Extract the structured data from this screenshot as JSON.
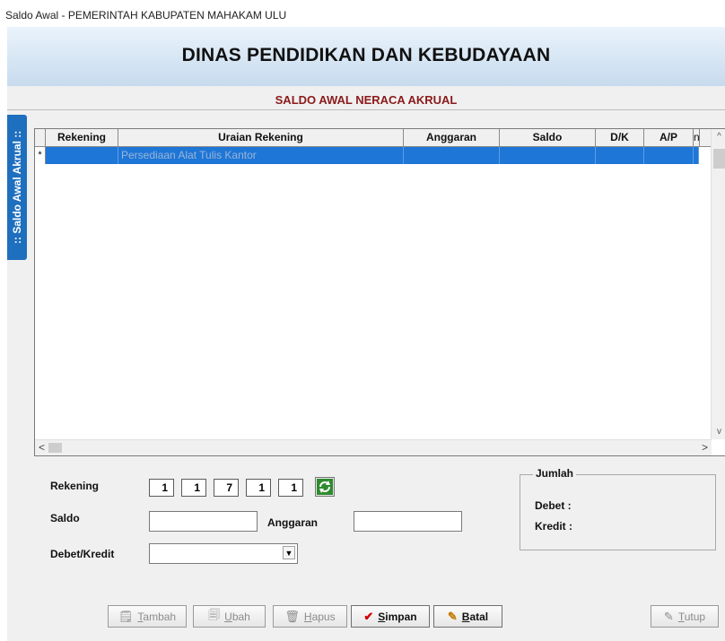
{
  "window": {
    "title": "Saldo Awal - PEMERINTAH KABUPATEN MAHAKAM ULU"
  },
  "header": {
    "title": "DINAS PENDIDIKAN DAN KEBUDAYAAN",
    "subtitle": "SALDO AWAL NERACA AKRUAL"
  },
  "sidetab": {
    "label": ":: Saldo Awal Akrual ::"
  },
  "grid": {
    "columns": [
      "Rekening",
      "Uraian Rekening",
      "Anggaran",
      "Saldo",
      "D/K",
      "A/P",
      "n"
    ],
    "rows": [
      {
        "indicator": "*",
        "rekening": "",
        "uraian": "Persediaan Alat Tulis Kantor",
        "anggaran": "",
        "saldo": "",
        "dk": "",
        "ap": "",
        "n": ""
      }
    ]
  },
  "form": {
    "rekening_label": "Rekening",
    "rekening_segments": [
      "1",
      "1",
      "7",
      "1",
      "1"
    ],
    "saldo_label": "Saldo",
    "saldo_value": "",
    "anggaran_label": "Anggaran",
    "anggaran_value": "",
    "dk_label": "Debet/Kredit",
    "dk_value": ""
  },
  "jumlah": {
    "legend": "Jumlah",
    "debet_label": "Debet  :",
    "kredit_label": "Kredit  :"
  },
  "buttons": {
    "tambah": "Tambah",
    "ubah": "Ubah",
    "hapus": "Hapus",
    "simpan": "Simpan",
    "batal": "Batal",
    "tutup": "Tutup"
  },
  "colors": {
    "selection": "#1e76d6",
    "sidetab": "#1f6fbf",
    "subtitle": "#8b1a1a"
  }
}
